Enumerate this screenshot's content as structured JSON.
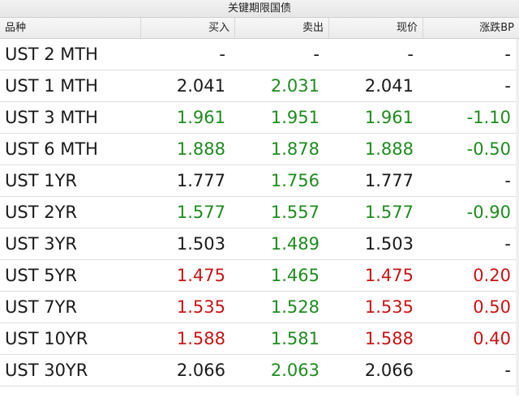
{
  "title": "关键期限国债",
  "headers": {
    "name": "品种",
    "buy": "买入",
    "sell": "卖出",
    "current": "现价",
    "change": "涨跌BP"
  },
  "colors": {
    "up": "#c81414",
    "down": "#1e8c1e",
    "neutral": "#1a1a1a"
  },
  "rows": [
    {
      "name": "UST 2 MTH",
      "buy": "-",
      "buy_color": "neutral",
      "sell": "-",
      "sell_color": "neutral",
      "current": "-",
      "current_color": "neutral",
      "change": "-",
      "change_color": "neutral"
    },
    {
      "name": "UST 1 MTH",
      "buy": "2.041",
      "buy_color": "neutral",
      "sell": "2.031",
      "sell_color": "green",
      "current": "2.041",
      "current_color": "neutral",
      "change": "-",
      "change_color": "neutral"
    },
    {
      "name": "UST 3 MTH",
      "buy": "1.961",
      "buy_color": "green",
      "sell": "1.951",
      "sell_color": "green",
      "current": "1.961",
      "current_color": "green",
      "change": "-1.10",
      "change_color": "green"
    },
    {
      "name": "UST 6 MTH",
      "buy": "1.888",
      "buy_color": "green",
      "sell": "1.878",
      "sell_color": "green",
      "current": "1.888",
      "current_color": "green",
      "change": "-0.50",
      "change_color": "green"
    },
    {
      "name": "UST 1YR",
      "buy": "1.777",
      "buy_color": "neutral",
      "sell": "1.756",
      "sell_color": "green",
      "current": "1.777",
      "current_color": "neutral",
      "change": "-",
      "change_color": "neutral"
    },
    {
      "name": "UST 2YR",
      "buy": "1.577",
      "buy_color": "green",
      "sell": "1.557",
      "sell_color": "green",
      "current": "1.577",
      "current_color": "green",
      "change": "-0.90",
      "change_color": "green"
    },
    {
      "name": "UST 3YR",
      "buy": "1.503",
      "buy_color": "neutral",
      "sell": "1.489",
      "sell_color": "green",
      "current": "1.503",
      "current_color": "neutral",
      "change": "-",
      "change_color": "neutral"
    },
    {
      "name": "UST 5YR",
      "buy": "1.475",
      "buy_color": "red",
      "sell": "1.465",
      "sell_color": "green",
      "current": "1.475",
      "current_color": "red",
      "change": "0.20",
      "change_color": "red"
    },
    {
      "name": "UST 7YR",
      "buy": "1.535",
      "buy_color": "red",
      "sell": "1.528",
      "sell_color": "green",
      "current": "1.535",
      "current_color": "red",
      "change": "0.50",
      "change_color": "red"
    },
    {
      "name": "UST 10YR",
      "buy": "1.588",
      "buy_color": "red",
      "sell": "1.581",
      "sell_color": "green",
      "current": "1.588",
      "current_color": "red",
      "change": "0.40",
      "change_color": "red"
    },
    {
      "name": "UST 30YR",
      "buy": "2.066",
      "buy_color": "neutral",
      "sell": "2.063",
      "sell_color": "green",
      "current": "2.066",
      "current_color": "neutral",
      "change": "-",
      "change_color": "neutral"
    }
  ]
}
